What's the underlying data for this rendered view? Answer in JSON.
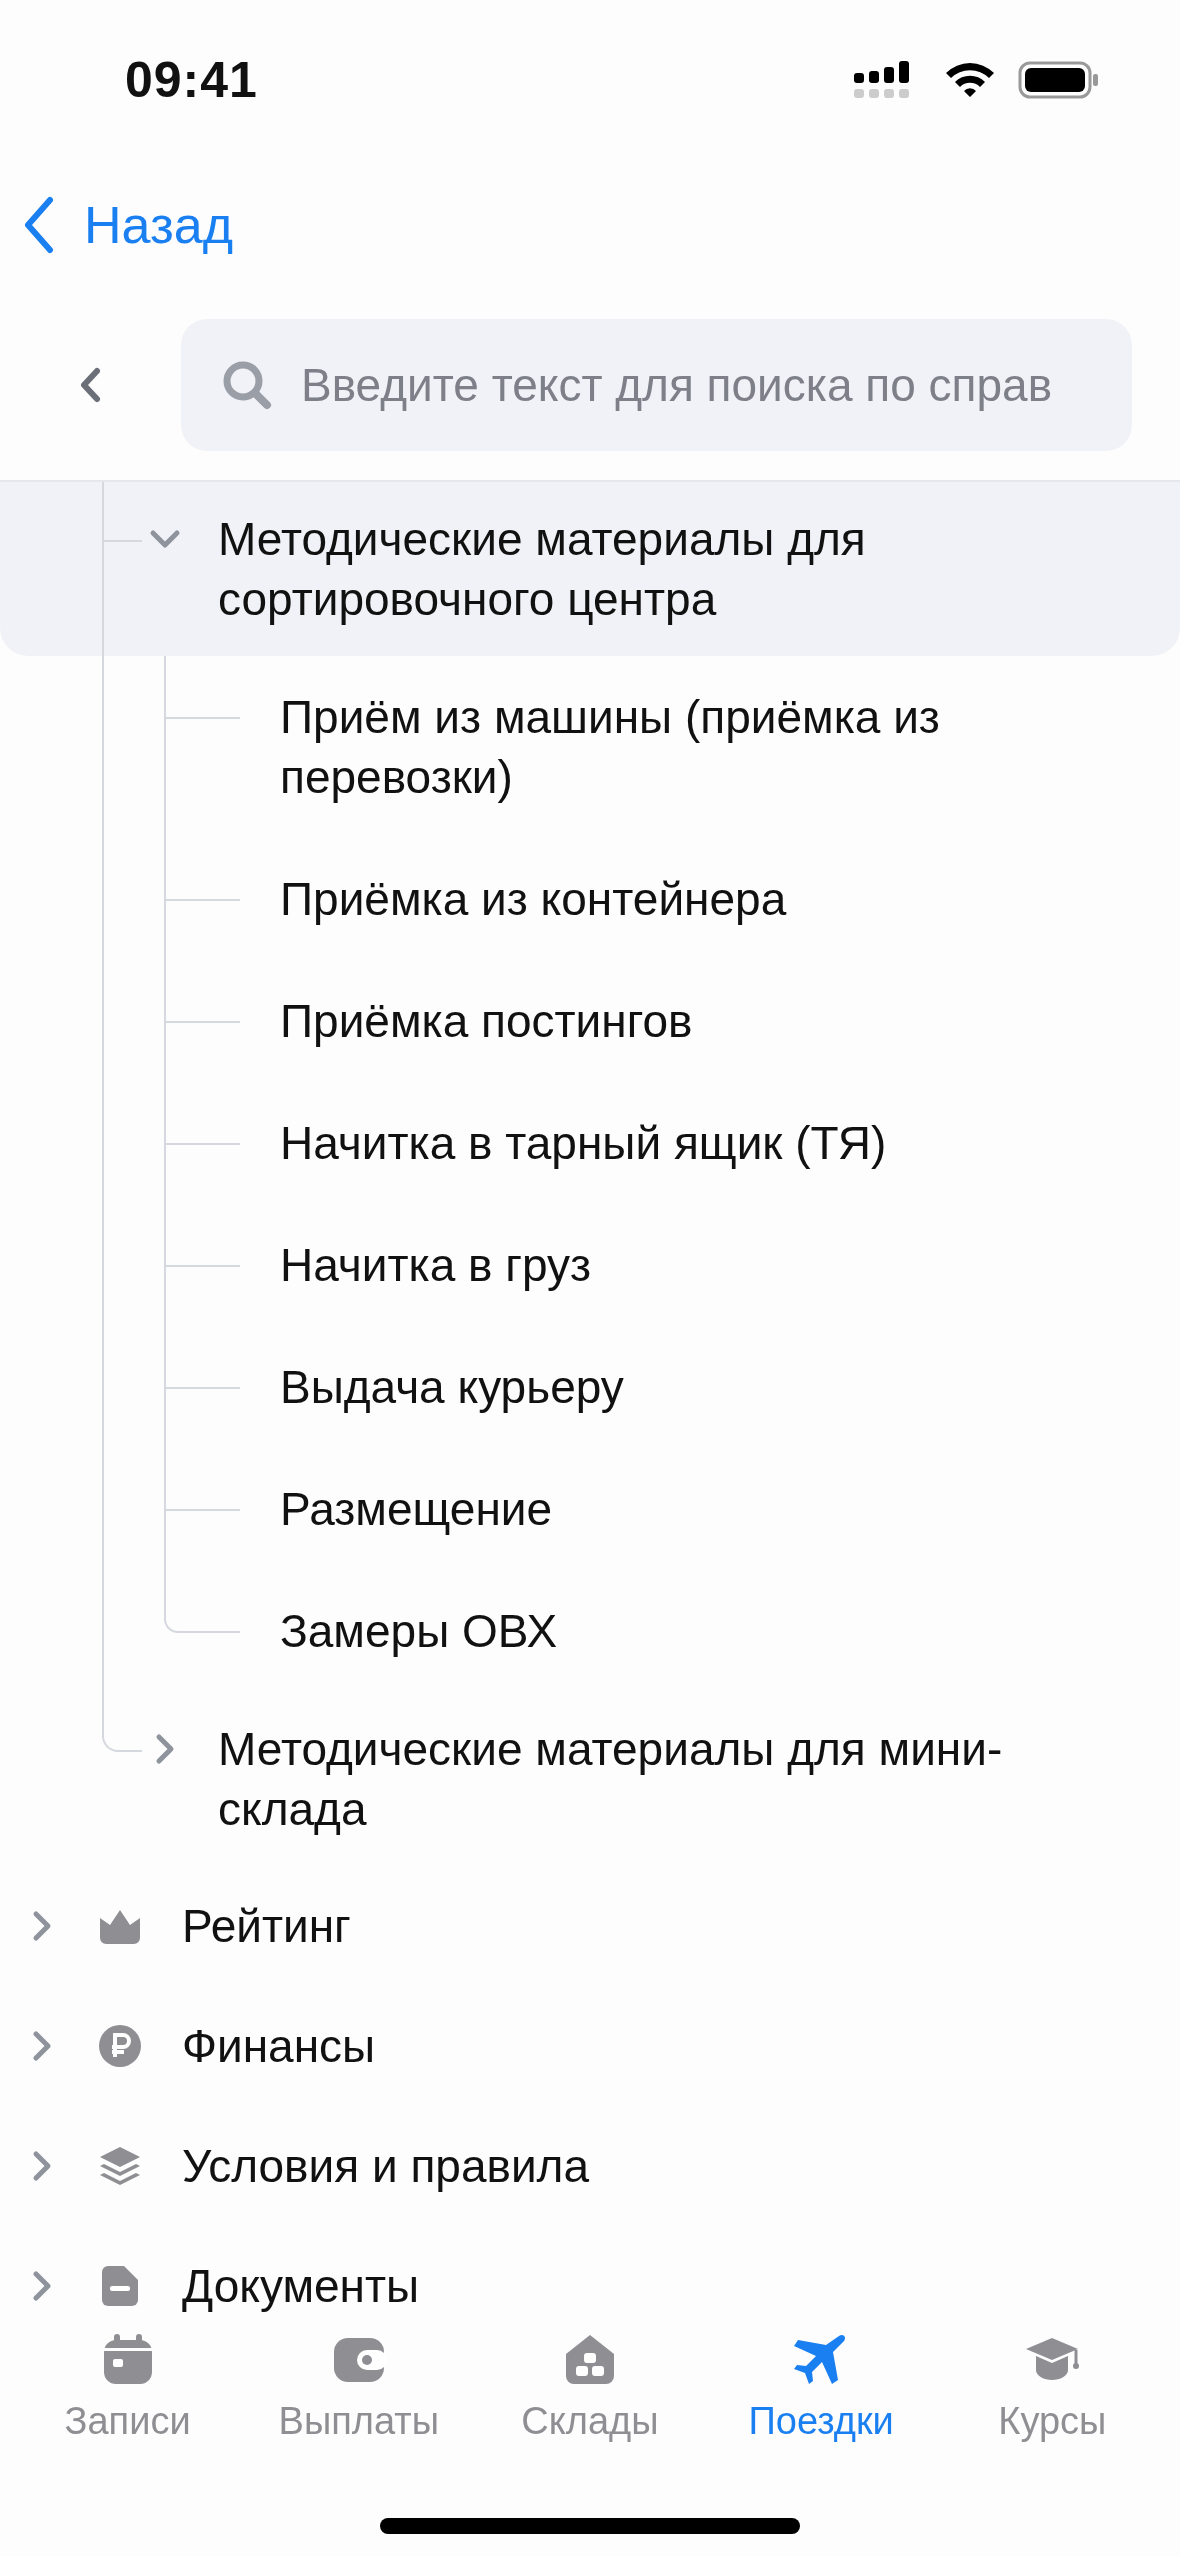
{
  "status_bar": {
    "time": "09:41"
  },
  "nav": {
    "back_label": "Назад"
  },
  "search": {
    "placeholder": "Введите текст для поиска по справ"
  },
  "tree": [
    {
      "label": "Методические материалы для сортировочного центра",
      "expanded": true,
      "selected": true,
      "children": [
        {
          "label": "Приём из машины (приёмка из перевозки)",
          "selected": false
        },
        {
          "label": "Приёмка из контейнера",
          "selected": false
        },
        {
          "label": "Приёмка постингов",
          "selected": false
        },
        {
          "label": "Начитка в тарный ящик (ТЯ)",
          "selected": false
        },
        {
          "label": "Начитка в груз",
          "selected": false
        },
        {
          "label": "Выдача курьеру",
          "selected": false
        },
        {
          "label": "Размещение",
          "selected": false
        },
        {
          "label": "Замеры ОВХ",
          "selected": false
        }
      ]
    },
    {
      "label": "Методические материалы для мини-склада",
      "expanded": false,
      "selected": false
    }
  ],
  "sections": [
    {
      "label": "Рейтинг",
      "kind": "crown",
      "expanded": false
    },
    {
      "label": "Финансы",
      "kind": "ruble",
      "expanded": false
    },
    {
      "label": "Условия и правила",
      "kind": "layers",
      "expanded": false
    },
    {
      "label": "Документы",
      "kind": "document",
      "expanded": false
    }
  ],
  "tab_bar": [
    {
      "label": "Записи",
      "kind": "calendar",
      "selected": false
    },
    {
      "label": "Выплаты",
      "kind": "wallet",
      "selected": false
    },
    {
      "label": "Склады",
      "kind": "house",
      "selected": false
    },
    {
      "label": "Поездки",
      "kind": "plane",
      "selected": true
    },
    {
      "label": "Курсы",
      "kind": "cap",
      "selected": false
    }
  ]
}
